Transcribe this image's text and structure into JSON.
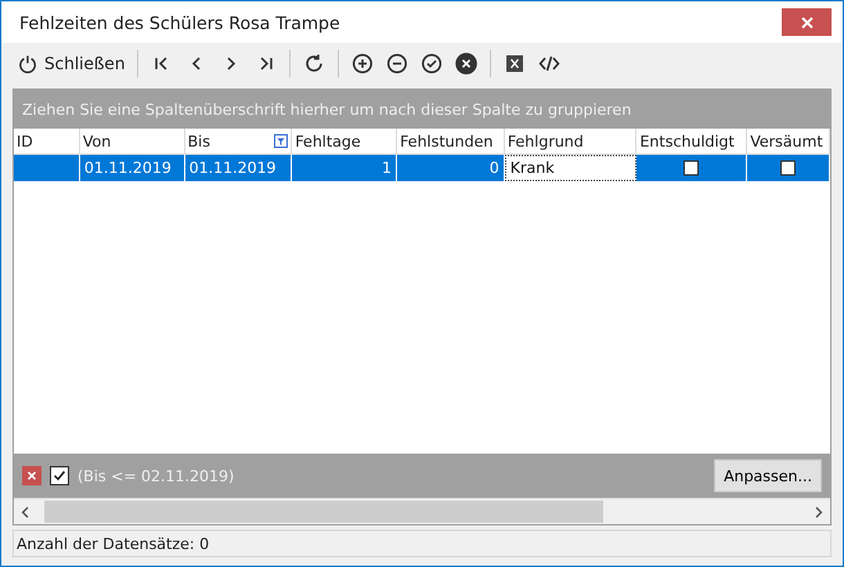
{
  "window": {
    "title": "Fehlzeiten des Schülers Rosa Trampe"
  },
  "toolbar": {
    "close_label": "Schließen"
  },
  "group_panel": {
    "text": "Ziehen Sie eine Spaltenüberschrift hierher um nach dieser Spalte zu gruppieren"
  },
  "table": {
    "columns": [
      {
        "label": "ID",
        "filtered": false
      },
      {
        "label": "Von",
        "filtered": false
      },
      {
        "label": "Bis",
        "filtered": true
      },
      {
        "label": "Fehltage",
        "filtered": false
      },
      {
        "label": "Fehlstunden",
        "filtered": false
      },
      {
        "label": "Fehlgrund",
        "filtered": false
      },
      {
        "label": "Entschuldigt",
        "filtered": false
      },
      {
        "label": "Versäumt",
        "filtered": false
      }
    ],
    "rows": [
      {
        "selected": true,
        "von": "01.11.2019",
        "bis": "01.11.2019",
        "fehltage": "1",
        "fehlstunden": "0",
        "fehlgrund": "Krank",
        "entschuldigt": false,
        "versaeumt": false
      }
    ]
  },
  "filter_bar": {
    "enabled": true,
    "text": "(Bis <= 02.11.2019)",
    "button": "Anpassen..."
  },
  "status_bar": {
    "text": "Anzahl der Datensätze: 0"
  }
}
